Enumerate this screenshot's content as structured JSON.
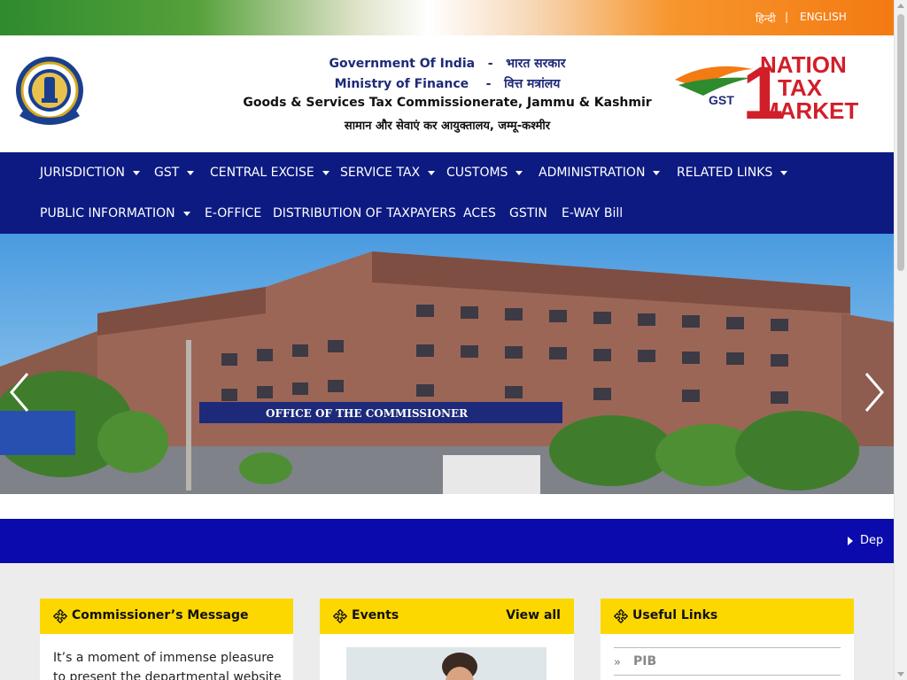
{
  "topbar": {
    "hindi_link": "हिन्दी",
    "separator": "|",
    "english_link": "ENGLISH"
  },
  "header": {
    "line1_en": "Government Of India",
    "line1_hi": "भारत सरकार",
    "line2_en": "Ministry of Finance",
    "line2_hi": "वित्त मत्रांलय",
    "dash": "-",
    "line3": "Goods & Services Tax Commissionerate, Jammu & Kashmir",
    "line4": "सामान और सेवाएं कर आयुक्तालय, जम्मू-कश्मीर"
  },
  "gst_logo": {
    "gst": "GST",
    "number": "1",
    "line1": "NATION",
    "line2": "TAX",
    "line3": "MARKET"
  },
  "nav": {
    "row1": [
      {
        "label": "JURISDICTION",
        "dropdown": true
      },
      {
        "label": "GST",
        "dropdown": true
      },
      {
        "label": "CENTRAL EXCISE",
        "dropdown": true
      },
      {
        "label": "SERVICE TAX",
        "dropdown": true
      },
      {
        "label": "CUSTOMS",
        "dropdown": true
      },
      {
        "label": "ADMINISTRATION",
        "dropdown": true
      },
      {
        "label": "RELATED LINKS",
        "dropdown": true
      }
    ],
    "row2": [
      {
        "label": "PUBLIC INFORMATION",
        "dropdown": true
      },
      {
        "label": "E-OFFICE",
        "dropdown": false
      },
      {
        "label": "DISTRIBUTION OF TAXPAYERS",
        "dropdown": false
      },
      {
        "label": "ACES",
        "dropdown": false
      },
      {
        "label": "GSTIN",
        "dropdown": false
      },
      {
        "label": "E-WAY Bill",
        "dropdown": false
      }
    ]
  },
  "hero": {
    "banner_text": "OFFICE OF THE COMMISSIONER"
  },
  "ticker": {
    "text": "Dep"
  },
  "cards": {
    "commissioner": {
      "title": "Commissioner’s Message",
      "text": "It’s a moment of immense pleasure to present the departmental website of"
    },
    "events": {
      "title": "Events",
      "view_all": "View all"
    },
    "useful_links": {
      "title": "Useful Links",
      "items": [
        "PIB"
      ]
    }
  },
  "colors": {
    "nav_bg": "#0c1a82",
    "ticker_bg": "#0a0aad",
    "card_header": "#fcd700",
    "header_text": "#1e2a78"
  }
}
